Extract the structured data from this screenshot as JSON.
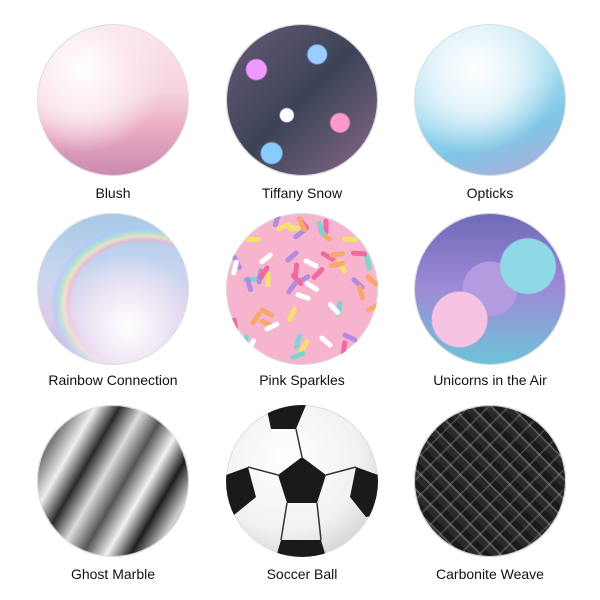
{
  "products": [
    {
      "name": "Blush",
      "pattern": "pink-glitter"
    },
    {
      "name": "Tiffany Snow",
      "pattern": "multicolor-bokeh"
    },
    {
      "name": "Opticks",
      "pattern": "blue-glitter"
    },
    {
      "name": "Rainbow Connection",
      "pattern": "clouds-rainbow"
    },
    {
      "name": "Pink Sparkles",
      "pattern": "sprinkles"
    },
    {
      "name": "Unicorns in the Air",
      "pattern": "unicorns"
    },
    {
      "name": "Ghost Marble",
      "pattern": "black-white-marble"
    },
    {
      "name": "Soccer Ball",
      "pattern": "soccer-ball"
    },
    {
      "name": "Carbonite Weave",
      "pattern": "carbon-fiber"
    }
  ],
  "colors": {
    "label": "#111111",
    "background": "#ffffff"
  }
}
